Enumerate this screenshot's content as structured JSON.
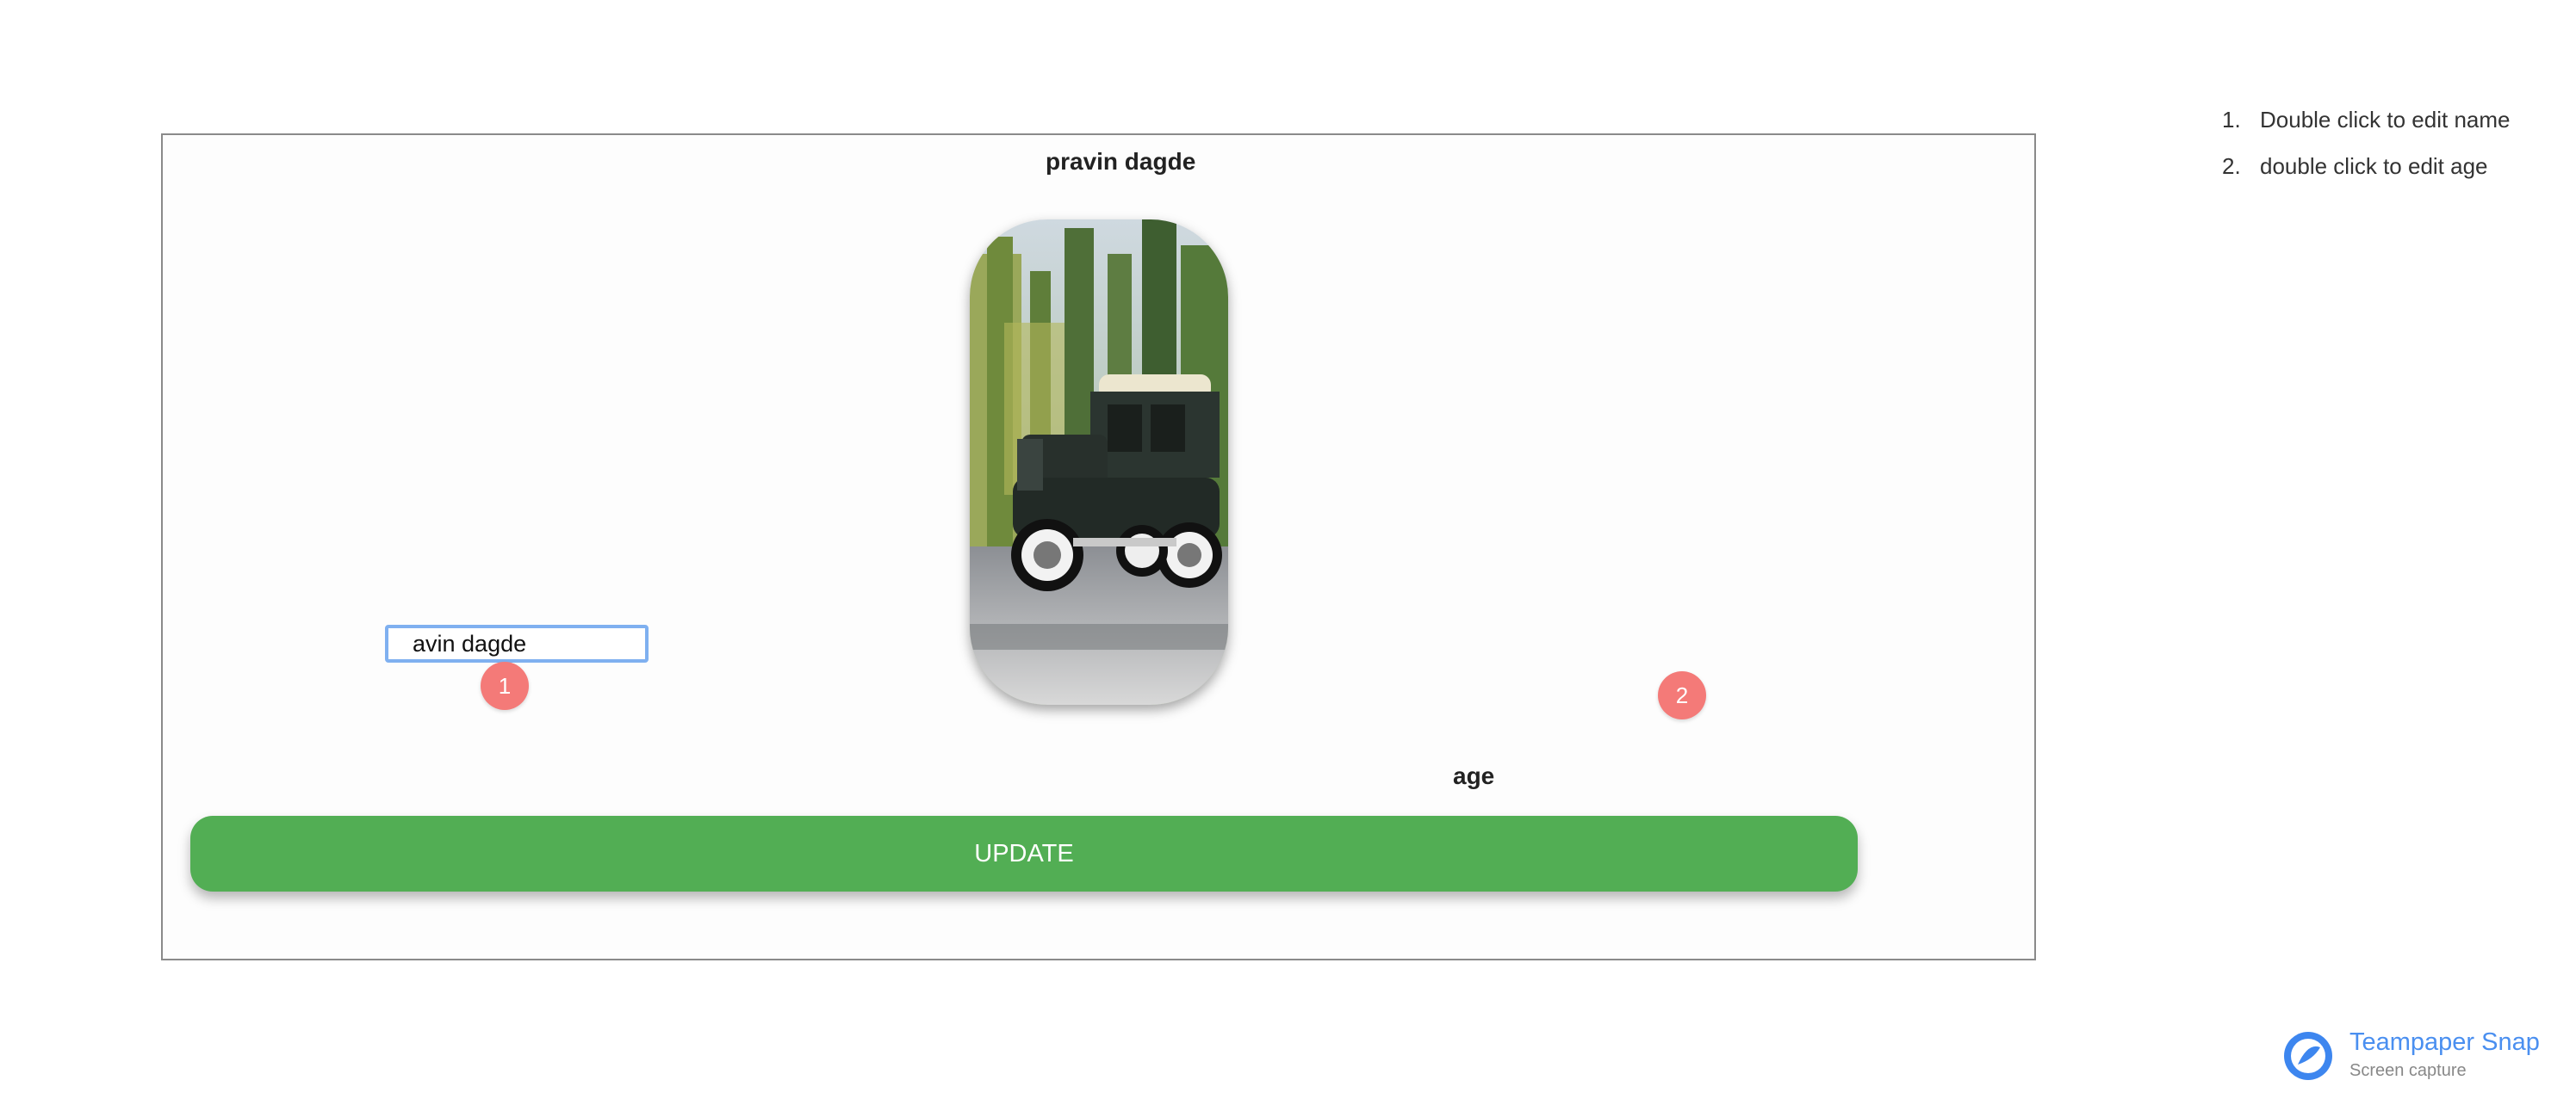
{
  "card": {
    "title": "pravin dagde",
    "photo_icon": "vintage-car-photo",
    "name_input_value": "avin dagde",
    "age_label": "age",
    "update_label": "UPDATE"
  },
  "markers": [
    "1",
    "2"
  ],
  "instructions": [
    {
      "num": "1.",
      "text": "Double click to edit name"
    },
    {
      "num": "2.",
      "text": "double click to edit age"
    }
  ],
  "brand": {
    "name": "Teampaper Snap",
    "subtitle": "Screen capture",
    "icon": "teampaper-logo-icon"
  },
  "colors": {
    "update_button": "#52ae54",
    "marker": "#f47a78",
    "brand": "#4a8ff0",
    "input_focus": "#7fb0f0"
  }
}
